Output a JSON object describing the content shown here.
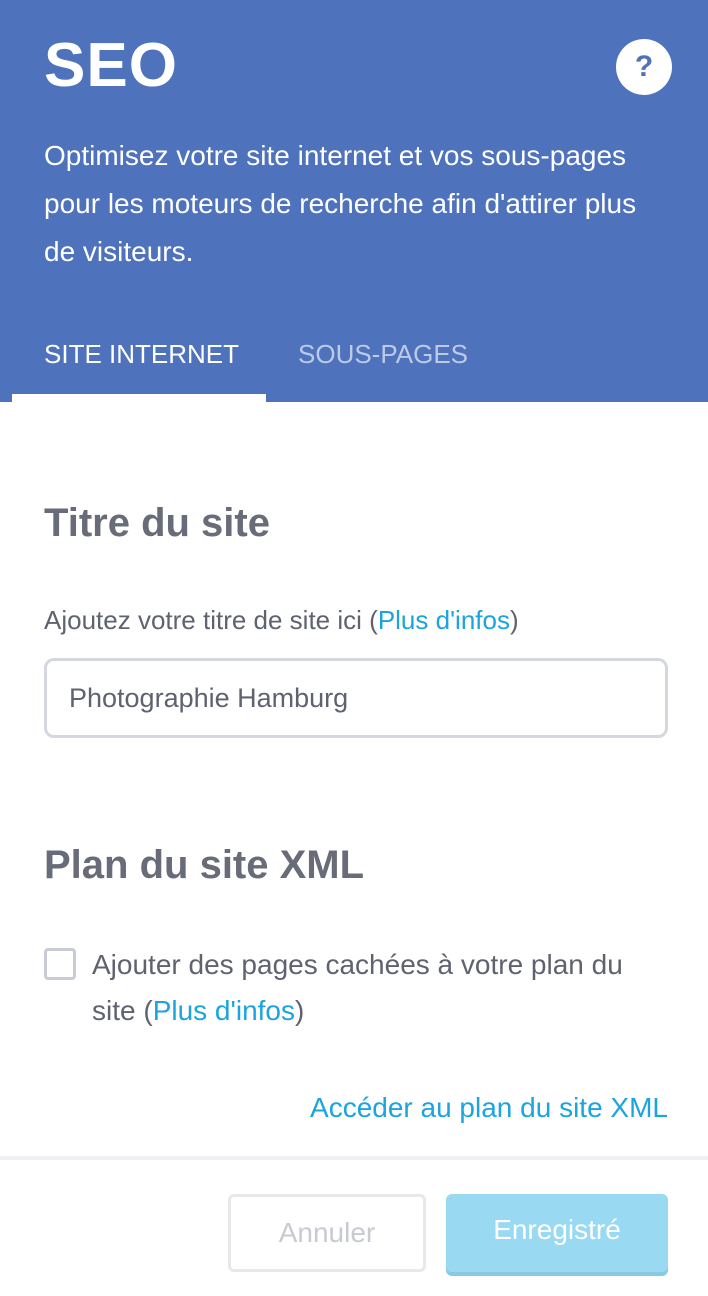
{
  "header": {
    "title": "SEO",
    "help_label": "?",
    "description": "Optimisez votre site internet et vos sous-pages pour les moteurs de recherche afin d'attirer plus de visiteurs.",
    "tabs": [
      {
        "label": "SITE INTERNET",
        "active": true
      },
      {
        "label": "SOUS-PAGES",
        "active": false
      }
    ]
  },
  "site_title": {
    "heading": "Titre du site",
    "label_prefix": "Ajoutez votre titre de site ici (",
    "label_link": "Plus d'infos",
    "label_suffix": ")",
    "input_value": "Photographie Hamburg"
  },
  "sitemap": {
    "heading": "Plan du site XML",
    "checkbox_checked": false,
    "checkbox_prefix": "Ajouter des pages cachées à votre plan du site (",
    "checkbox_link": "Plus d'infos",
    "checkbox_suffix": ")",
    "access_link": "Accéder au plan du site XML"
  },
  "footer": {
    "cancel_label": "Annuler",
    "save_label": "Enregistré"
  },
  "colors": {
    "header_bg": "#4e72bc",
    "link": "#1ba4dd",
    "save_button": "#99d9f2"
  }
}
